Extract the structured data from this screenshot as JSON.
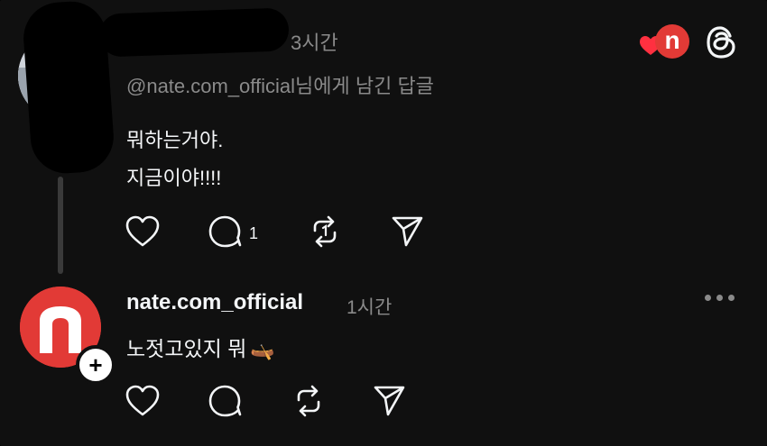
{
  "reply_post": {
    "time": "3시간",
    "reply_to": "@nate.com_official님에게 남긴 답글",
    "lines": [
      "뭐하는거야.",
      "지금이야!!!!"
    ],
    "comment_count": "1"
  },
  "nate_post": {
    "username": "nate.com_official",
    "time": "1시간",
    "text": "노젓고있지 뭐",
    "emoji": "🛶"
  },
  "header": {
    "nate_logo_letter": "n"
  },
  "colors": {
    "background": "#101010",
    "nate_red": "#e23a36",
    "heart_red": "#ff3040",
    "muted": "#8a8a8a"
  },
  "icons": [
    "heart-icon",
    "comment-icon",
    "repost-icon",
    "share-icon",
    "threads-logo-icon",
    "more-icon",
    "plus-icon"
  ]
}
